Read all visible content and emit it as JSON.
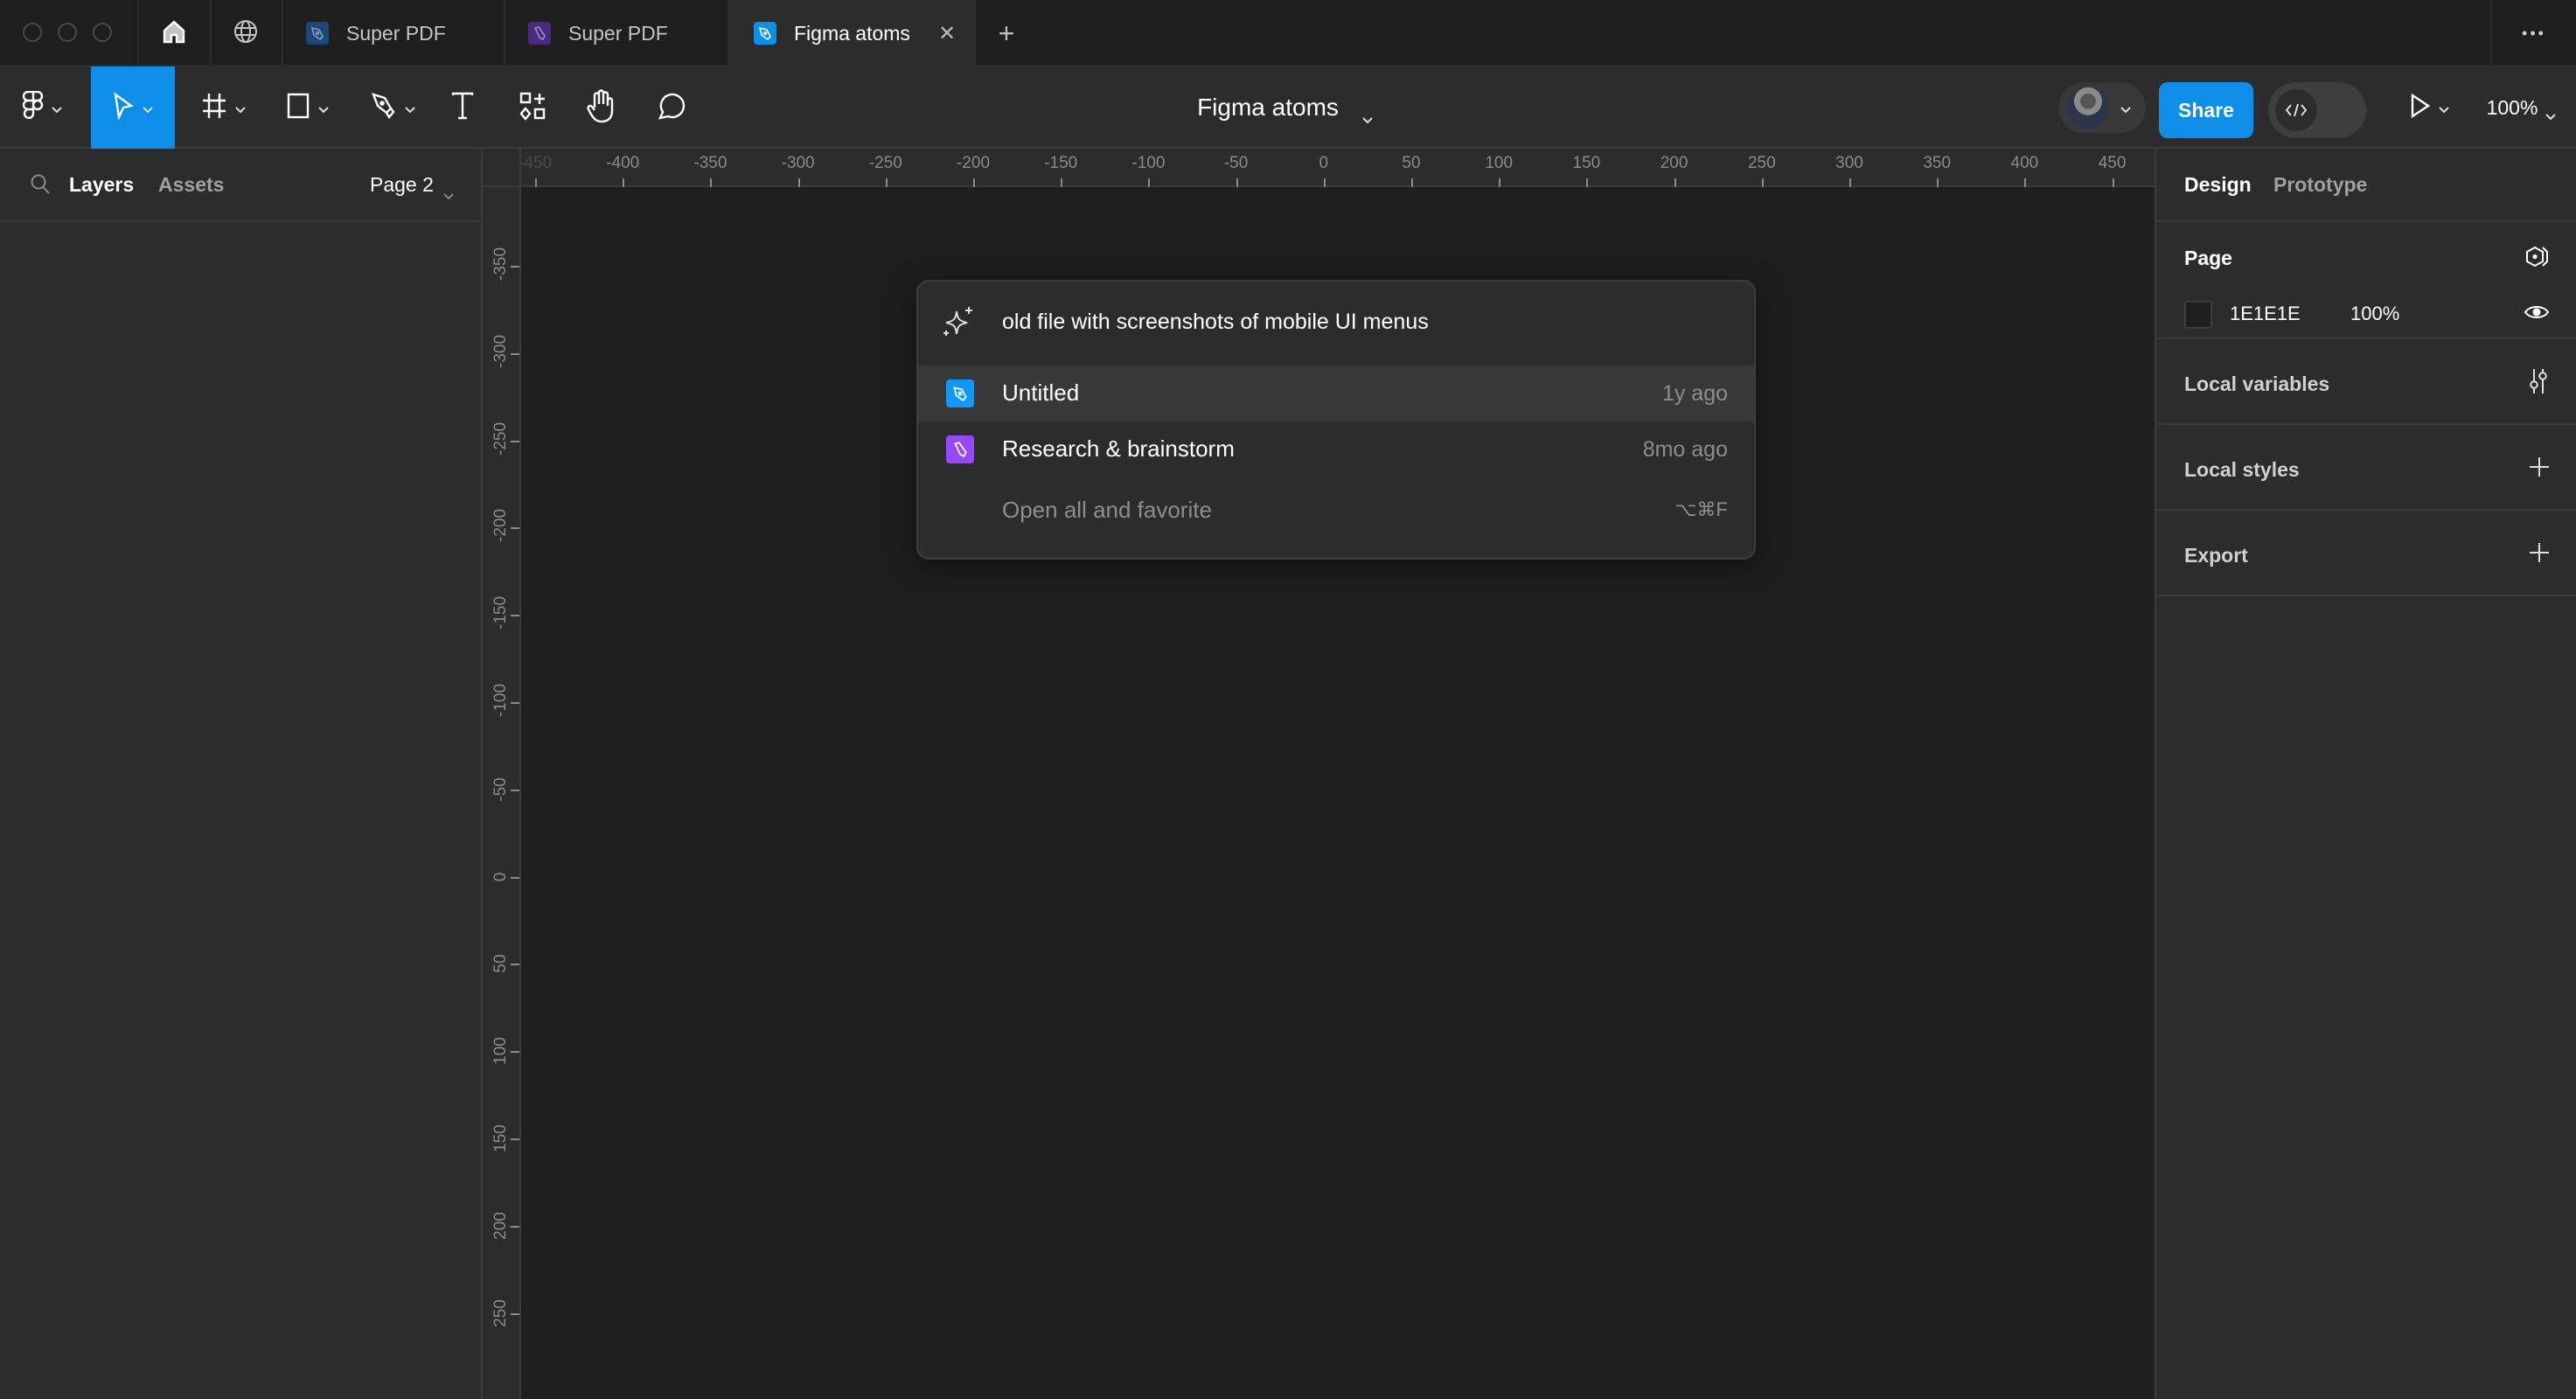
{
  "tabbar": {
    "tabs": [
      {
        "label": "Super PDF",
        "icon": "figma-design-file-icon",
        "icon_color": "#1b4a78",
        "active": false
      },
      {
        "label": "Super PDF",
        "icon": "figjam-file-icon",
        "icon_color": "#4a2a80",
        "active": false
      },
      {
        "label": "Figma atoms",
        "icon": "figma-design-file-icon",
        "icon_color": "#0d8ee9",
        "active": true
      }
    ],
    "close_glyph": "✕",
    "new_tab_glyph": "+",
    "more_glyph": "•••"
  },
  "toolbar": {
    "file_name": "Figma atoms",
    "share_label": "Share",
    "zoom_level": "100%",
    "tools": [
      "main-menu",
      "move",
      "frame",
      "shape",
      "pen",
      "text",
      "resources",
      "hand",
      "comment"
    ],
    "active_tool": "move",
    "accent_color": "#0d8ee9"
  },
  "left_panel": {
    "tabs": [
      "Layers",
      "Assets"
    ],
    "active_tab": "Layers",
    "page_selector": "Page 2"
  },
  "rulers": {
    "horizontal": [
      "-450",
      "-400",
      "-350",
      "-300",
      "-250",
      "-200",
      "-150",
      "-100",
      "-50",
      "0",
      "50",
      "100",
      "150",
      "200",
      "250",
      "300",
      "350",
      "400",
      "450"
    ],
    "vertical": [
      "-350",
      "-300",
      "-250",
      "-200",
      "-150",
      "-100",
      "-50",
      "0",
      "50",
      "100",
      "150",
      "200",
      "250"
    ]
  },
  "search_popup": {
    "query": "old file with screenshots of mobile UI menus",
    "results": [
      {
        "title": "Untitled",
        "time": "1y ago",
        "icon": "figma-design-file-icon",
        "icon_color": "#0d99ff",
        "highlighted": true
      },
      {
        "title": "Research & brainstorm",
        "time": "8mo ago",
        "icon": "figjam-file-icon",
        "icon_color": "#9747ff",
        "highlighted": false
      }
    ],
    "action": {
      "label": "Open all and favorite",
      "shortcut": "⌥⌘F"
    }
  },
  "right_panel": {
    "tabs": [
      "Design",
      "Prototype"
    ],
    "active_tab": "Design",
    "page_section": {
      "title": "Page",
      "background_hex": "1E1E1E",
      "background_color": "#1e1e1e",
      "opacity": "100%"
    },
    "sections": [
      {
        "title": "Local variables",
        "icon": "variables-icon"
      },
      {
        "title": "Local styles",
        "icon": "plus-icon"
      },
      {
        "title": "Export",
        "icon": "plus-icon"
      }
    ]
  }
}
